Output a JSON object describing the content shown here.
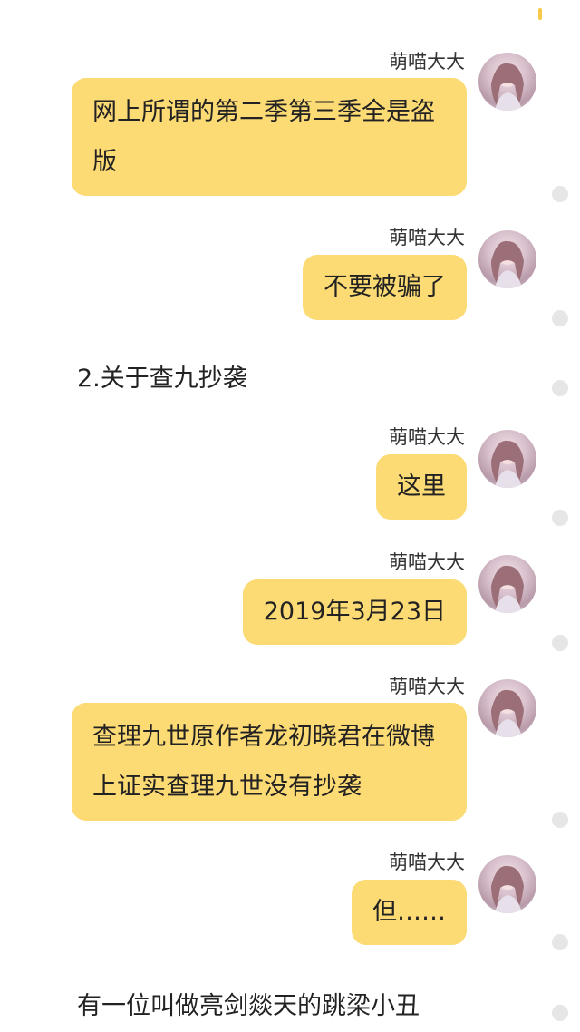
{
  "messages": [
    {
      "sender": "萌喵大大",
      "text": "网上所谓的第二季第三季全是盗版"
    },
    {
      "sender": "萌喵大大",
      "text": "不要被骗了"
    },
    {
      "sender": "萌喵大大",
      "text": "这里"
    },
    {
      "sender": "萌喵大大",
      "text": "2019年3月23日"
    },
    {
      "sender": "萌喵大大",
      "text": "查理九世原作者龙初晓君在微博上证实查理九世没有抄袭"
    },
    {
      "sender": "萌喵大大",
      "text": "但……"
    }
  ],
  "plain_texts": [
    "2.关于查九抄袭",
    "有一位叫做亮剑燚天的跳梁小丑"
  ],
  "colors": {
    "bubble": "#fcda74",
    "dot": "#e6e6e6",
    "background": "#ffffff"
  },
  "icons": {
    "avatar": "anime-girl-avatar",
    "status_dot": "grey-dot"
  }
}
